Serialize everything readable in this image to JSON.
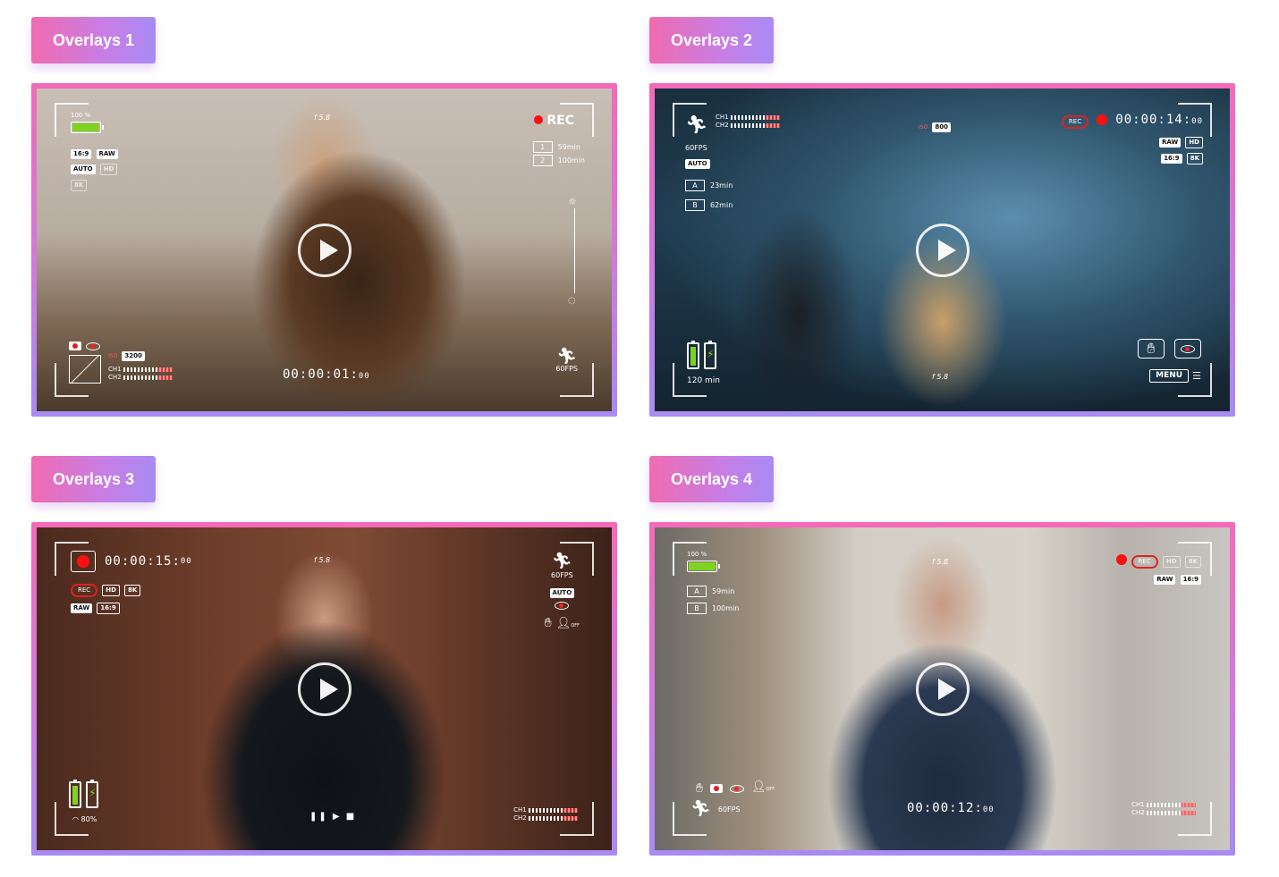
{
  "cards": [
    {
      "tag": "Overlays 1",
      "hud": {
        "battery_pct": "100 %",
        "battery_level": 1.0,
        "badges_row1": [
          "16:9",
          "RAW"
        ],
        "badges_row2": [
          "AUTO",
          "HD"
        ],
        "badges_row3": [
          "8K"
        ],
        "aperture": "f 5.8",
        "rec": "REC",
        "slots": [
          {
            "id": "1",
            "time": "59min"
          },
          {
            "id": "2",
            "time": "100min"
          }
        ],
        "iso_label": "ISO",
        "iso": "3200",
        "ch1": "CH1",
        "ch2": "CH2",
        "timecode": "00:00:01",
        "frames": "00",
        "fps": "60FPS"
      }
    },
    {
      "tag": "Overlays 2",
      "hud": {
        "ch1": "CH1",
        "ch2": "CH2",
        "iso_label": "ISO",
        "iso": "800",
        "rec": "REC",
        "timecode": "00:00:14",
        "frames": "00",
        "badges_row1": [
          "RAW",
          "HD"
        ],
        "badges_row2": [
          "16:9",
          "8K"
        ],
        "fps": "60FPS",
        "mode": "AUTO",
        "slots": [
          {
            "id": "A",
            "time": "23min"
          },
          {
            "id": "B",
            "time": "62min"
          }
        ],
        "battery_text": "120 min",
        "aperture": "f 5.8",
        "menu": "MENU"
      }
    },
    {
      "tag": "Overlays 3",
      "hud": {
        "timecode": "00:00:15",
        "frames": "00",
        "aperture": "f 5.8",
        "rec": "REC",
        "badges_row1": [
          "HD",
          "8K"
        ],
        "badges_row2": [
          "RAW",
          "16:9"
        ],
        "fps": "60FPS",
        "mode": "AUTO",
        "wifi_pct": "80%",
        "transport": "❚❚ ▶ ■",
        "ch1": "CH1",
        "ch2": "CH2",
        "off": "OFF"
      }
    },
    {
      "tag": "Overlays 4",
      "hud": {
        "battery_pct": "100 %",
        "battery_level": 1.0,
        "slots": [
          {
            "id": "A",
            "time": "59min"
          },
          {
            "id": "B",
            "time": "100min"
          }
        ],
        "aperture": "f 5.8",
        "rec": "REC",
        "badges_row1": [
          "HD",
          "8K"
        ],
        "badges_row2": [
          "RAW",
          "16:9"
        ],
        "fps": "60FPS",
        "timecode": "00:00:12",
        "frames": "00",
        "ch1": "CH1",
        "ch2": "CH2",
        "off": "OFF"
      }
    }
  ]
}
